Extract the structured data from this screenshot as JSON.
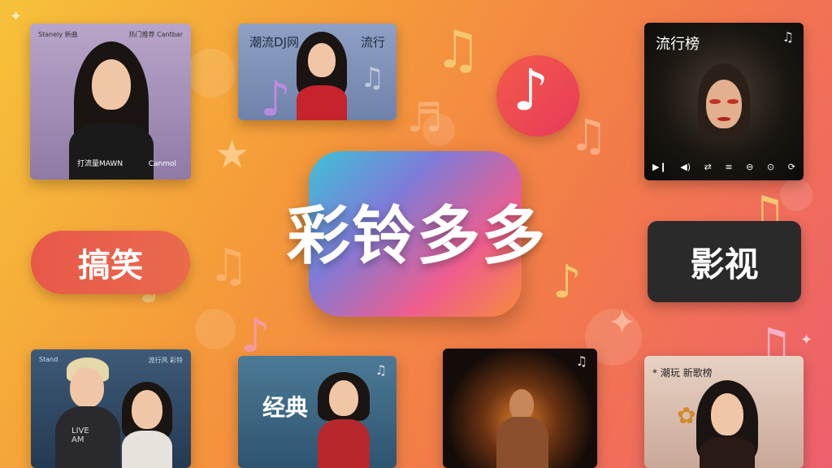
{
  "app_title": "彩铃多多",
  "categories": {
    "funny": "搞笑",
    "film": "影视"
  },
  "cards": {
    "top_left": {
      "header_left": "Stanely 新曲",
      "header_right": "热门推荐 Cantbar",
      "footer_left": "打流量MAWN",
      "footer_right": "Canmol"
    },
    "top_mid": {
      "title_left": "潮流DJ网",
      "title_right": "流行"
    },
    "top_right": {
      "title": "流行榜"
    },
    "bot_left": {
      "header_left": "Stand",
      "header_right": "流行风 彩铃",
      "shirt": "LIVE AM"
    },
    "bot_mid": {
      "title": "经典"
    },
    "bot_right": {
      "title": "* 潮玩 新歌榜"
    }
  },
  "icons": [
    "music-note-icon",
    "star-icon",
    "play-icon",
    "volume-icon",
    "repeat-icon",
    "heart-icon"
  ],
  "colors": {
    "accent_orange": "#f0893a",
    "pill_funny": "#e8584a",
    "pill_film": "#2b2b2b",
    "logo_grad_start": "#f6b33a",
    "logo_grad_end": "#ee4f7a"
  }
}
